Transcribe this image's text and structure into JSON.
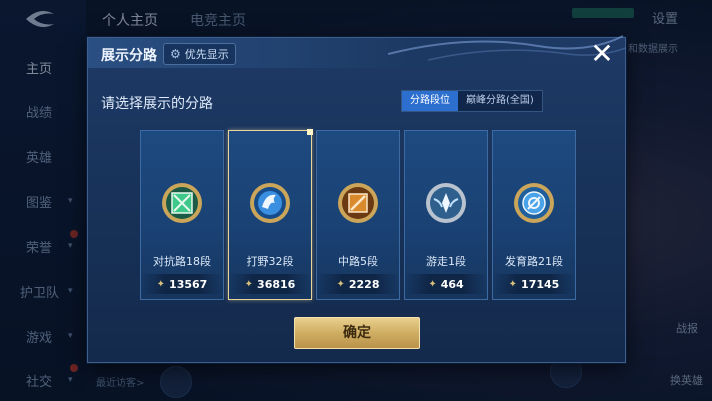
{
  "background": {
    "top_tabs": [
      "个人主页",
      "电竞主页"
    ],
    "settings_label": "设置",
    "right_text": "和数据展示",
    "sidebar_items": [
      {
        "label": "主页",
        "active": true,
        "chevron": false
      },
      {
        "label": "战绩",
        "active": false,
        "chevron": false
      },
      {
        "label": "英雄",
        "active": false,
        "chevron": false
      },
      {
        "label": "图鉴",
        "active": false,
        "chevron": true
      },
      {
        "label": "荣誉",
        "active": false,
        "chevron": true,
        "badge": true
      },
      {
        "label": "护卫队",
        "active": false,
        "chevron": true
      },
      {
        "label": "游戏",
        "active": false,
        "chevron": true
      },
      {
        "label": "社交",
        "active": false,
        "chevron": true,
        "badge": true
      }
    ],
    "recent_visitors": "最近访客>",
    "right_buttons": [
      "战报",
      "换英雄"
    ]
  },
  "modal": {
    "title": "展示分路",
    "priority_label": "优先显示",
    "close_symbol": "✕",
    "prompt": "请选择展示的分路",
    "tabs": [
      {
        "label": "分路段位",
        "active": true
      },
      {
        "label": "巅峰分路(全国)",
        "active": false
      }
    ],
    "lanes": [
      {
        "name": "对抗路18段",
        "score": "13567",
        "icon": "clash-lane-emblem-icon",
        "color": "#3ec98a",
        "selected": false
      },
      {
        "name": "打野32段",
        "score": "36816",
        "icon": "jungle-dragon-emblem-icon",
        "color": "#3b8fe0",
        "selected": true
      },
      {
        "name": "中路5段",
        "score": "2228",
        "icon": "mid-lane-emblem-icon",
        "color": "#d88a2c",
        "selected": false
      },
      {
        "name": "游走1段",
        "score": "464",
        "icon": "roam-wings-emblem-icon",
        "color": "#7fb6e6",
        "selected": false
      },
      {
        "name": "发育路21段",
        "score": "17145",
        "icon": "farm-lane-emblem-icon",
        "color": "#4aa3e8",
        "selected": false
      }
    ],
    "confirm_label": "确定"
  },
  "colors": {
    "accent_gold": "#d8bf7c",
    "active_tab": "#2c6fcf",
    "panel": "#1a3a66"
  }
}
